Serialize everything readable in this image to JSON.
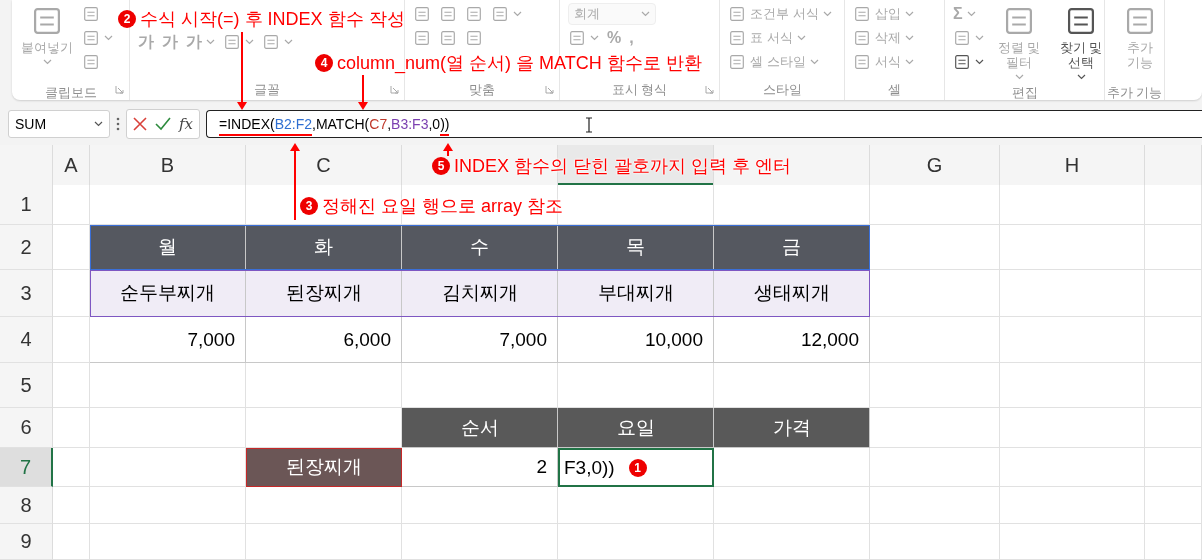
{
  "ribbon": {
    "groups": [
      {
        "label": "클립보드",
        "launcher": true,
        "columns": [
          [
            [
              {
                "kind": "large",
                "label": "붙여넣기",
                "menu": true,
                "disabled": true
              }
            ]
          ],
          [
            [
              {
                "kind": "icon",
                "menu": false,
                "disabled": true
              }
            ],
            [
              {
                "kind": "icon",
                "menu": true,
                "disabled": true
              }
            ],
            [
              {
                "kind": "icon",
                "menu": false,
                "disabled": true
              }
            ]
          ]
        ]
      },
      {
        "label": "글꼴",
        "launcher": true,
        "columns": [
          [
            [
              {
                "kind": "glyph",
                "label": "가",
                "menu": false,
                "disabled": true
              },
              {
                "kind": "glyph",
                "label": "가",
                "menu": false,
                "disabled": true
              },
              {
                "kind": "glyph",
                "label": "가",
                "menu": true,
                "disabled": true
              },
              {
                "kind": "icon",
                "menu": true,
                "disabled": true
              },
              {
                "kind": "icon",
                "menu": true,
                "disabled": true
              }
            ]
          ]
        ]
      },
      {
        "label": "맞춤",
        "launcher": true,
        "columns": [
          [
            [
              {
                "kind": "icon",
                "menu": false,
                "disabled": true
              },
              {
                "kind": "icon",
                "menu": false,
                "disabled": true
              },
              {
                "kind": "icon",
                "menu": false,
                "disabled": true
              },
              {
                "kind": "icon",
                "menu": true,
                "disabled": true
              }
            ],
            [
              {
                "kind": "icon",
                "menu": false,
                "disabled": true
              },
              {
                "kind": "icon",
                "menu": false,
                "disabled": true
              },
              {
                "kind": "icon",
                "menu": false,
                "disabled": true
              }
            ]
          ]
        ]
      },
      {
        "label": "표시 형식",
        "launcher": true,
        "columns": [
          [
            [
              {
                "kind": "combo",
                "label": "회계",
                "menu": true,
                "disabled": true
              }
            ],
            [
              {
                "kind": "icon",
                "menu": true,
                "disabled": true
              },
              {
                "kind": "glyph",
                "label": "%",
                "menu": false,
                "disabled": true
              },
              {
                "kind": "glyph",
                "label": ",",
                "menu": false,
                "disabled": true
              }
            ]
          ]
        ]
      },
      {
        "label": "스타일",
        "launcher": false,
        "columns": [
          [
            [
              {
                "kind": "small",
                "label": "조건부 서식",
                "menu": true,
                "disabled": true
              }
            ],
            [
              {
                "kind": "small",
                "label": "표 서식",
                "menu": true,
                "disabled": true
              }
            ],
            [
              {
                "kind": "small",
                "label": "셀 스타일",
                "menu": true,
                "disabled": true
              }
            ]
          ]
        ]
      },
      {
        "label": "셀",
        "launcher": false,
        "columns": [
          [
            [
              {
                "kind": "small",
                "label": "삽입",
                "menu": true,
                "disabled": true
              }
            ],
            [
              {
                "kind": "small",
                "label": "삭제",
                "menu": true,
                "disabled": true
              }
            ],
            [
              {
                "kind": "small",
                "label": "서식",
                "menu": true,
                "disabled": true
              }
            ]
          ]
        ]
      },
      {
        "label": "편집",
        "launcher": false,
        "columns": [
          [
            [
              {
                "kind": "glyph",
                "label": "Σ",
                "menu": true,
                "disabled": true
              }
            ],
            [
              {
                "kind": "icon",
                "menu": true,
                "disabled": true
              }
            ],
            [
              {
                "kind": "icon",
                "menu": true,
                "disabled": false
              }
            ]
          ],
          [
            [
              {
                "kind": "large",
                "label": "정렬 및 필터",
                "menu": true,
                "disabled": true
              }
            ]
          ],
          [
            [
              {
                "kind": "large",
                "label": "찾기 및 선택",
                "menu": true,
                "disabled": false
              }
            ]
          ]
        ]
      },
      {
        "label": "추가 기능",
        "launcher": false,
        "columns": [
          [
            [
              {
                "kind": "large",
                "label": "추가 기능",
                "menu": false,
                "disabled": true
              }
            ]
          ]
        ]
      }
    ]
  },
  "formula_bar": {
    "name_box": "SUM",
    "function_label": "fx",
    "parts": [
      {
        "text": "=INDEX(",
        "underlined": true
      },
      {
        "text": "B2:F2",
        "color": "#2f6fd1",
        "underlined": true
      },
      {
        "text": ",MATCH(",
        "underlined": false
      },
      {
        "text": "C7",
        "color": "#c0392b",
        "underlined": false
      },
      {
        "text": ",",
        "underlined": false
      },
      {
        "text": "B3:F3",
        "color": "#7b3fb0",
        "underlined": false
      },
      {
        "text": ",0",
        "underlined": false
      },
      {
        "text": "))",
        "underlined": true
      }
    ]
  },
  "sheet": {
    "columns": [
      {
        "label": "A",
        "selected": false
      },
      {
        "label": "B",
        "selected": false
      },
      {
        "label": "C",
        "selected": false
      },
      {
        "selected": false
      },
      {
        "selected": true
      },
      {
        "selected": false
      },
      {
        "label": "G",
        "selected": false
      },
      {
        "label": "H",
        "selected": false
      },
      {
        "selected": false
      }
    ],
    "rows": [
      {
        "label": "1",
        "selected": false
      },
      {
        "label": "2",
        "selected": false
      },
      {
        "label": "3",
        "selected": false
      },
      {
        "label": "4",
        "selected": false
      },
      {
        "label": "5",
        "selected": false
      },
      {
        "label": "6",
        "selected": false
      },
      {
        "label": "7",
        "selected": true
      },
      {
        "label": "8",
        "selected": false
      },
      {
        "label": "9",
        "selected": false
      }
    ],
    "day_table": {
      "days": [
        "월",
        "화",
        "수",
        "목",
        "금"
      ],
      "dishes": [
        "순두부찌개",
        "된장찌개",
        "김치찌개",
        "부대찌개",
        "생태찌개"
      ],
      "prices": [
        "7,000",
        "6,000",
        "7,000",
        "10,000",
        "12,000"
      ]
    },
    "lookup": {
      "query": "된장찌개",
      "headers": [
        "순서",
        "요일",
        "가격"
      ],
      "order": "2",
      "active_input": "F3,0))"
    }
  },
  "callouts": [
    {
      "kind": "label",
      "marker": "2",
      "text": "수식 시작(=) 후 INDEX 함수 작성"
    },
    {
      "kind": "label",
      "marker": "4",
      "text": "column_num(열 순서) 을 MATCH 함수로 반환"
    },
    {
      "kind": "label",
      "marker": "5",
      "text": "INDEX 함수의 닫힌 괄호까지 입력 후 엔터"
    },
    {
      "kind": "label",
      "marker": "3",
      "text": "정해진 요일 행으로 array 참조"
    },
    {
      "kind": "cell_marker",
      "marker": "1"
    }
  ]
}
